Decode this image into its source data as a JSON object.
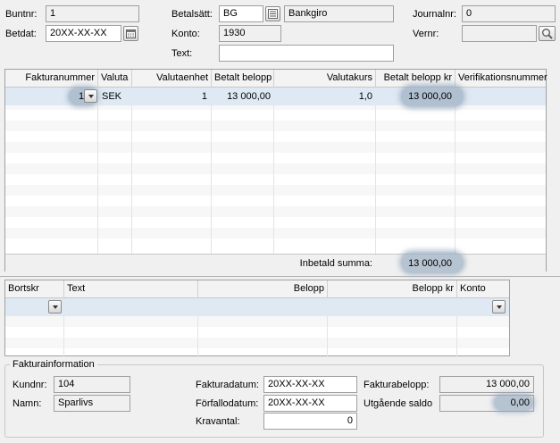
{
  "top": {
    "buntnr_label": "Buntnr:",
    "buntnr_value": "1",
    "betdat_label": "Betdat:",
    "betdat_value": "20XX-XX-XX",
    "betalsatt_label": "Betalsätt:",
    "betalsatt_value": "BG",
    "betalsatt_name": "Bankgiro",
    "konto_label": "Konto:",
    "konto_value": "1930",
    "text_label": "Text:",
    "text_value": "",
    "journalnr_label": "Journalnr:",
    "journalnr_value": "0",
    "vernr_label": "Vernr:",
    "vernr_value": ""
  },
  "grid1": {
    "headers": [
      "Fakturanummer",
      "Valuta",
      "Valutaenhet",
      "Betalt belopp",
      "Valutakurs",
      "Betalt belopp kr",
      "Verifikationsnummer"
    ],
    "row": [
      "1",
      "SEK",
      "1",
      "13 000,00",
      "1,0",
      "13 000,00",
      ""
    ],
    "footer_label": "Inbetald summa:",
    "footer_value": "13 000,00"
  },
  "grid2": {
    "headers": [
      "Bortskr",
      "Text",
      "Belopp",
      "Belopp kr",
      "Konto"
    ]
  },
  "faktura": {
    "group_title": "Fakturainformation",
    "kundnr_label": "Kundnr:",
    "kundnr_value": "104",
    "namn_label": "Namn:",
    "namn_value": "Sparlivs",
    "fakturadatum_label": "Fakturadatum:",
    "fakturadatum_value": "20XX-XX-XX",
    "forfallodatum_label": "Förfallodatum:",
    "forfallodatum_value": "20XX-XX-XX",
    "kravantal_label": "Kravantal:",
    "kravantal_value": "0",
    "fakturabelopp_label": "Fakturabelopp:",
    "fakturabelopp_value": "13 000,00",
    "utgaende_label": "Utgående saldo",
    "utgaende_value": "0,00"
  },
  "icons": [
    "calendar-icon",
    "list-icon",
    "search-icon",
    "chevron-down-icon"
  ]
}
